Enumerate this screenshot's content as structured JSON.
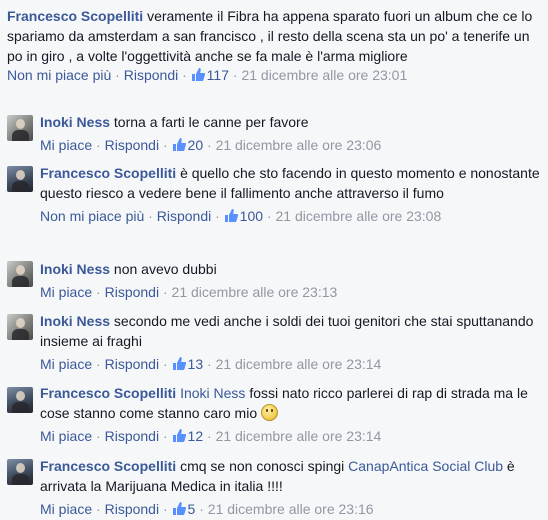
{
  "top_comment": {
    "author": "Francesco Scopelliti",
    "text": "veramente il Fibra ha appena sparato fuori un album che ce lo spariamo da amsterdam a san francisco , il resto della scena sta un po' a tenerife un po in giro , a volte l'oggettività anche se fa male è l'arma migliore",
    "action1": "Non mi piace più",
    "action2": "Rispondi",
    "likes": "117",
    "time": "21 dicembre alle ore 23:01"
  },
  "replies": [
    {
      "author": "Inoki Ness",
      "text": "torna a farti le canne per favore",
      "action1": "Mi piace",
      "action2": "Rispondi",
      "likes": "20",
      "time": "21 dicembre alle ore 23:06"
    },
    {
      "author": "Francesco Scopelliti",
      "text": "è quello che sto facendo in questo momento e nonostante questo riesco a vedere bene il fallimento anche attraverso il fumo",
      "action1": "Non mi piace più",
      "action2": "Rispondi",
      "likes": "100",
      "time": "21 dicembre alle ore 23:08"
    },
    {
      "author": "Inoki Ness",
      "text": "non avevo dubbi",
      "action1": "Mi piace",
      "action2": "Rispondi",
      "time": "21 dicembre alle ore 23:13"
    },
    {
      "author": "Inoki Ness",
      "text": "secondo me vedi anche i soldi dei tuoi genitori che stai sputtanando insieme ai fraghi",
      "action1": "Mi piace",
      "action2": "Rispondi",
      "likes": "13",
      "time": "21 dicembre alle ore 23:14"
    },
    {
      "author": "Francesco Scopelliti",
      "mention": "Inoki Ness",
      "text": "fossi nato ricco parlerei di rap di strada ma le cose stanno come stanno caro mio",
      "action1": "Mi piace",
      "action2": "Rispondi",
      "likes": "12",
      "time": "21 dicembre alle ore 23:14"
    },
    {
      "author": "Francesco Scopelliti",
      "text_before": "cmq se non conosci spingi",
      "link": "CanapAntica Social Club",
      "text_after": "è arrivata la Marijuana Medica in italia !!!!",
      "action1": "Mi piace",
      "action2": "Rispondi",
      "likes": "5",
      "time": "21 dicembre alle ore 23:16"
    }
  ],
  "separator": "·",
  "colors": {
    "link": "#3b5998",
    "meta_gray": "#9197a3",
    "text": "#141823",
    "background": "#f6f7f9"
  },
  "icons": {
    "like": "thumbs-up-icon",
    "avatar": "profile-photo",
    "smiley": "smiley-emoji"
  }
}
